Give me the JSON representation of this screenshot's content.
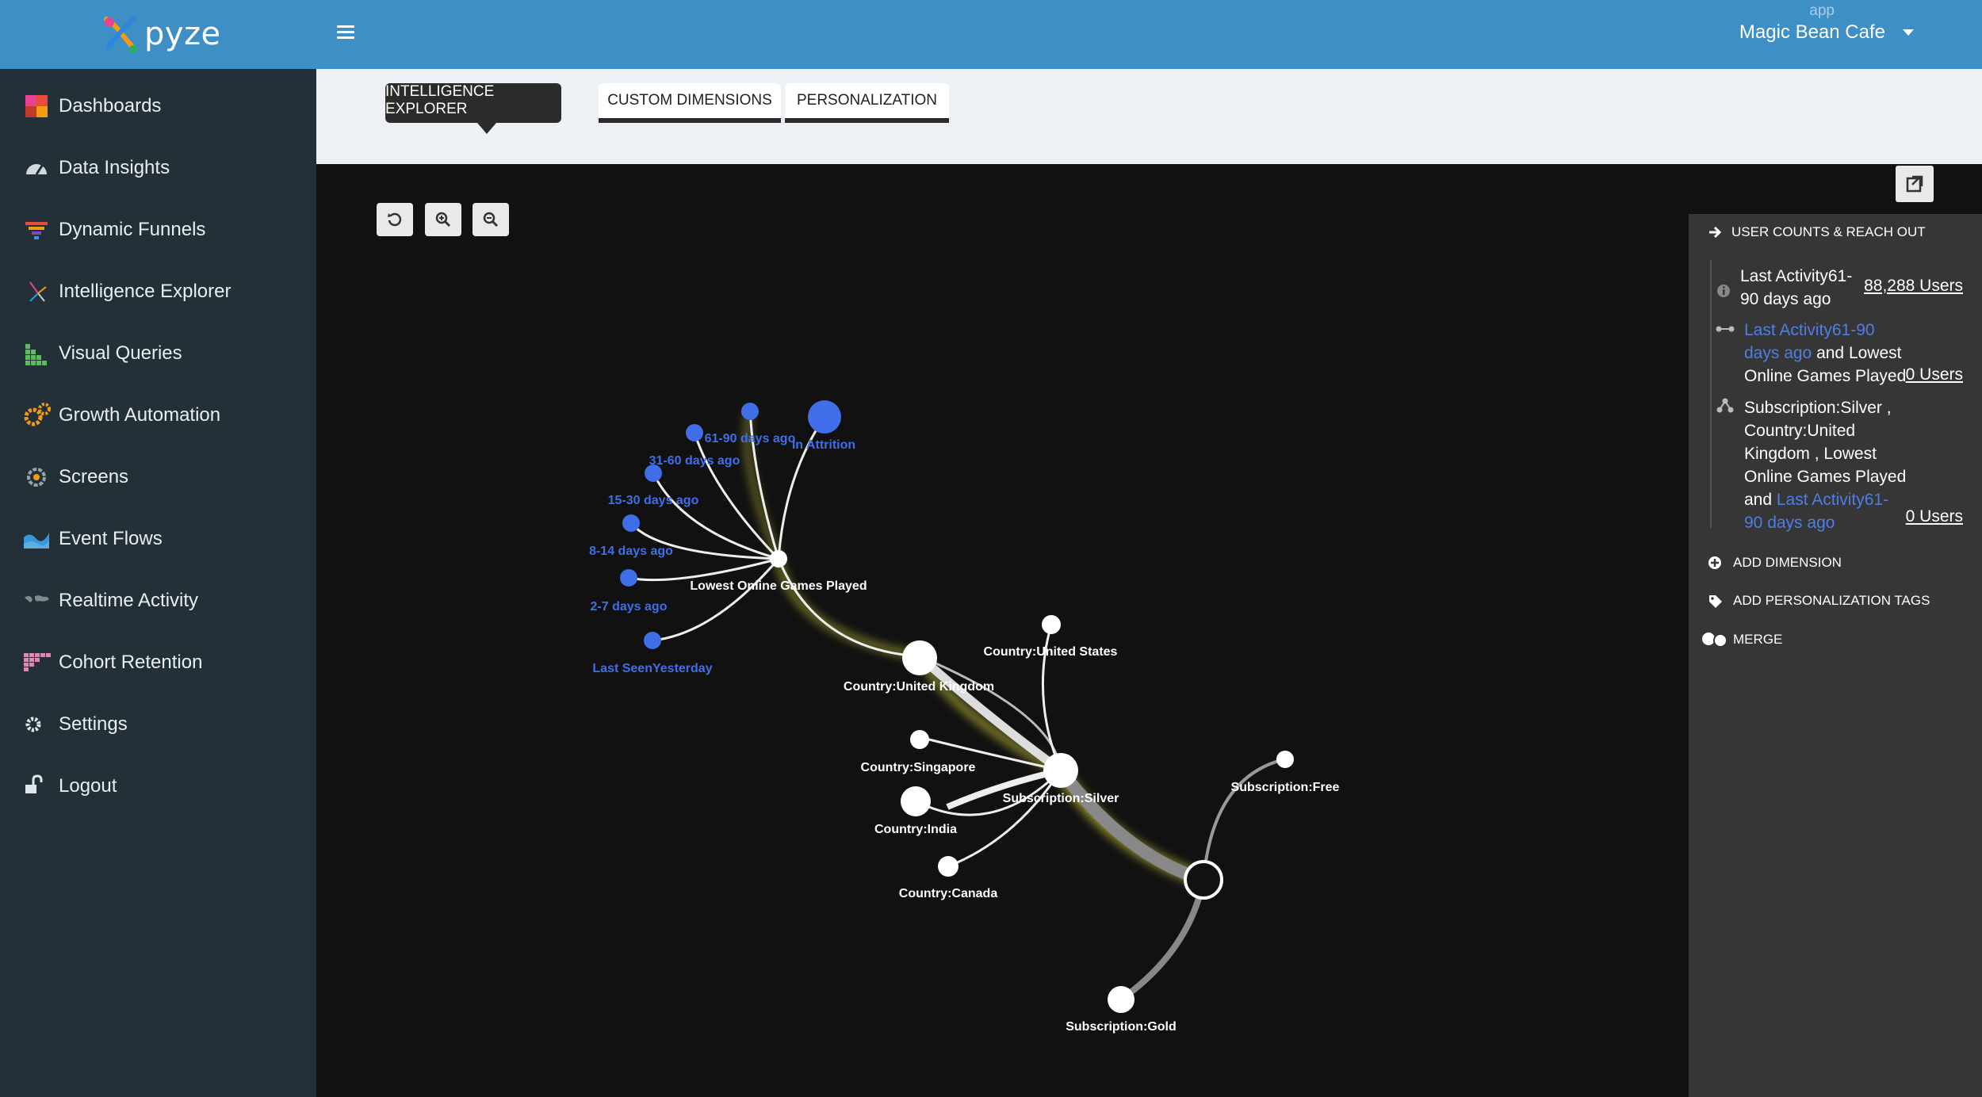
{
  "brand": {
    "name": "pyze"
  },
  "sidebar": {
    "items": [
      {
        "label": "Dashboards",
        "icon": "dashboard-grid-icon"
      },
      {
        "label": "Data Insights",
        "icon": "gauge-icon"
      },
      {
        "label": "Dynamic Funnels",
        "icon": "funnel-icon"
      },
      {
        "label": "Intelligence Explorer",
        "icon": "explorer-icon"
      },
      {
        "label": "Visual Queries",
        "icon": "staircase-icon"
      },
      {
        "label": "Growth Automation",
        "icon": "gears-icon"
      },
      {
        "label": "Screens",
        "icon": "screens-icon"
      },
      {
        "label": "Event Flows",
        "icon": "flow-icon"
      },
      {
        "label": "Realtime Activity",
        "icon": "world-map-icon"
      },
      {
        "label": "Cohort Retention",
        "icon": "cohort-grid-icon"
      },
      {
        "label": "Settings",
        "icon": "gear-icon"
      },
      {
        "label": "Logout",
        "icon": "unlock-icon"
      }
    ]
  },
  "header": {
    "app_label": "app",
    "app_name": "Magic Bean Cafe"
  },
  "tabs": [
    {
      "label": "INTELLIGENCE EXPLORER"
    },
    {
      "label": "CUSTOM DIMENSIONS"
    },
    {
      "label": "PERSONALIZATION"
    }
  ],
  "graph": {
    "nodes": {
      "attrition": "In Attrition",
      "d61_90": "61-90 days ago",
      "d31_60": "31-60 days ago",
      "d15_30": "15-30 days ago",
      "d8_14": "8-14 days ago",
      "d2_7": "2-7 days ago",
      "last_seen": "Last SeenYesterday",
      "lowest_online": "Lowest Online Games Played",
      "uk": "Country:United Kingdom",
      "us": "Country:United States",
      "singapore": "Country:Singapore",
      "india": "Country:India",
      "canada": "Country:Canada",
      "silver": "Subscription:Silver",
      "free": "Subscription:Free",
      "gold": "Subscription:Gold"
    },
    "colors": {
      "background": "#111111",
      "node_blue": "#3f6ee8",
      "node_white": "#ffffff",
      "highlight": "#c8c23a"
    }
  },
  "panel": {
    "heading": "USER COUNTS & REACH OUT",
    "r1_link": "Last Activity61-\n90 days ago",
    "r1_count": "88,288 Users",
    "r2_link": "Last Activity61-90\ndays ago",
    "r2_rest": " and Lowest\nOnline Games Played",
    "r2_count": "0 Users",
    "r3_text": "Subscription:Silver ,\nCountry:United\nKingdom ,  Lowest\nOnline Games Played\n and ",
    "r3_link": "Last Activity61-\n90 days ago",
    "r3_count": "0 Users",
    "add_dimension": "ADD DIMENSION",
    "add_tags": "ADD PERSONALIZATION TAGS",
    "merge": "MERGE"
  }
}
